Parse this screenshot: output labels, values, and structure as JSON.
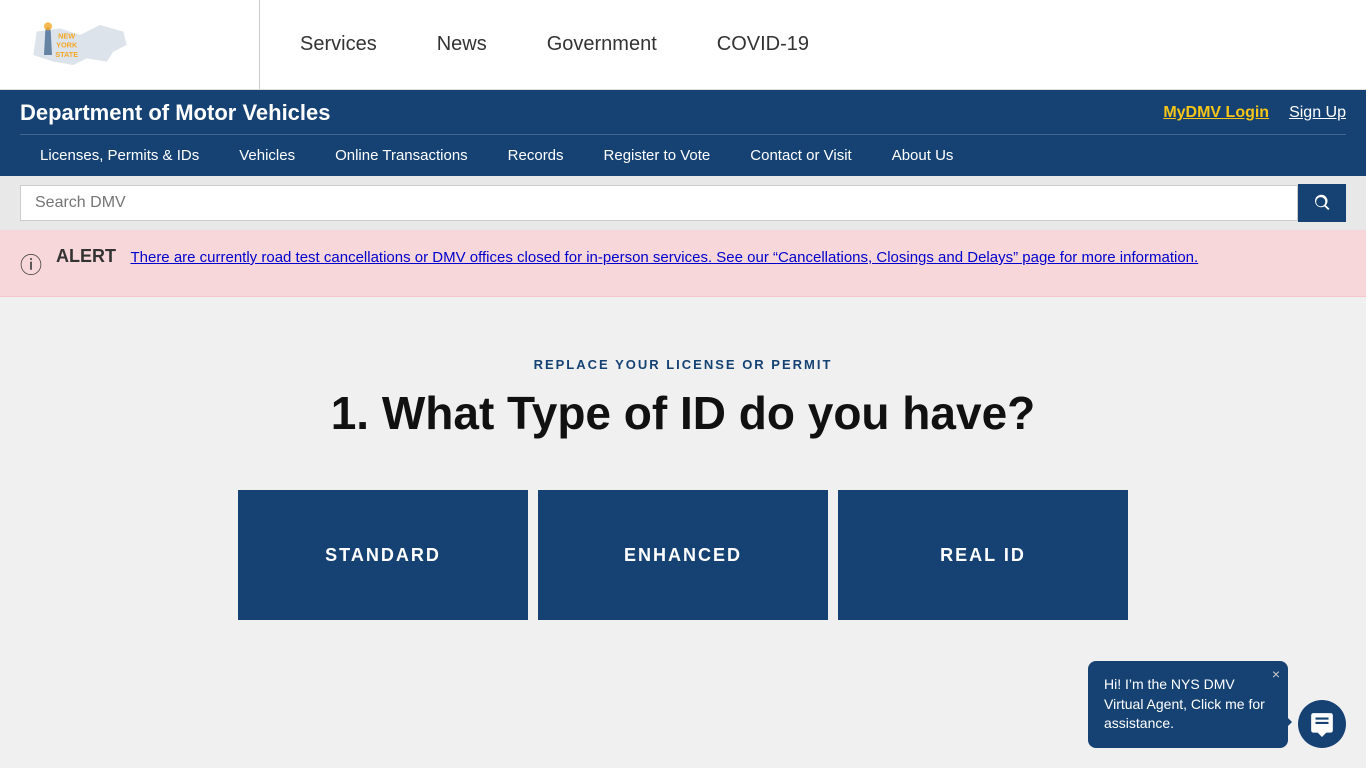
{
  "topbar": {
    "logo_alt": "New York State",
    "nav_items": [
      {
        "label": "Services",
        "id": "services"
      },
      {
        "label": "News",
        "id": "news"
      },
      {
        "label": "Government",
        "id": "government"
      },
      {
        "label": "COVID-19",
        "id": "covid19"
      }
    ]
  },
  "dmv_header": {
    "title": "Department of Motor Vehicles",
    "login_label": "MyDMV Login",
    "signup_label": "Sign Up",
    "nav_items": [
      {
        "label": "Licenses, Permits & IDs"
      },
      {
        "label": "Vehicles"
      },
      {
        "label": "Online Transactions"
      },
      {
        "label": "Records"
      },
      {
        "label": "Register to Vote"
      },
      {
        "label": "Contact or Visit"
      },
      {
        "label": "About Us"
      }
    ]
  },
  "search": {
    "placeholder": "Search DMV"
  },
  "alert": {
    "label": "ALERT",
    "text": "There are currently road test cancellations or DMV offices closed for in-person services. See our “Cancellations, Closings and Delays” page for more information."
  },
  "main": {
    "step_label": "REPLACE YOUR LICENSE OR PERMIT",
    "heading": "1. What Type of ID do you have?",
    "cards": [
      {
        "label": "Standard"
      },
      {
        "label": "Enhanced"
      },
      {
        "label": "REAL ID"
      }
    ]
  },
  "chatbot": {
    "bubble_text": "Hi! I’m the NYS DMV Virtual Agent, Click me for assistance.",
    "close_label": "×"
  }
}
